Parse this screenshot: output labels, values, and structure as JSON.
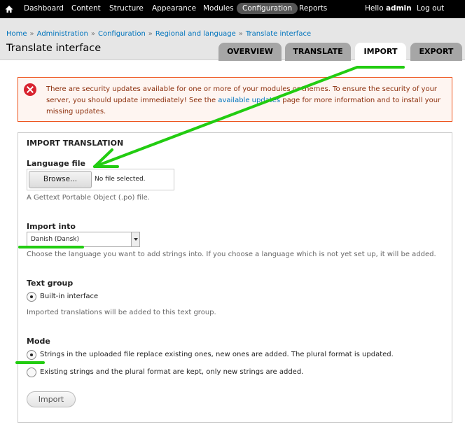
{
  "toolbar": {
    "items": [
      "Dashboard",
      "Content",
      "Structure",
      "Appearance",
      "Modules",
      "Configuration",
      "Reports"
    ],
    "hello_prefix": "Hello",
    "user": "admin",
    "logout": "Log out"
  },
  "breadcrumb": [
    "Home",
    "Administration",
    "Configuration",
    "Regional and language",
    "Translate interface"
  ],
  "breadcrumb_separator": "»",
  "page_title": "Translate interface",
  "tabs": [
    "OVERVIEW",
    "TRANSLATE",
    "IMPORT",
    "EXPORT"
  ],
  "active_tab": "IMPORT",
  "message": {
    "part1": "There are security updates available for one or more of your modules or themes. To ensure the security of your server, you should update immediately! See the ",
    "link": "available updates",
    "part2": " page for more information and to install your missing updates."
  },
  "form": {
    "legend": "IMPORT TRANSLATION",
    "file": {
      "label": "Language file",
      "button": "Browse...",
      "status": "No file selected.",
      "description": "A Gettext Portable Object (.po) file."
    },
    "import_into": {
      "label": "Import into",
      "selected": "Danish (Dansk)",
      "description": "Choose the language you want to add strings into. If you choose a language which is not yet set up, it will be added."
    },
    "text_group": {
      "label": "Text group",
      "option": "Built-in interface",
      "description": "Imported translations will be added to this text group."
    },
    "mode": {
      "label": "Mode",
      "options": [
        "Strings in the uploaded file replace existing ones, new ones are added. The plural format is updated.",
        "Existing strings and the plural format are kept, only new strings are added."
      ],
      "selected_index": 0
    },
    "submit": "Import"
  },
  "colors": {
    "toolbar_bg": "#000000",
    "link": "#0074bd",
    "error_border": "#ed541d",
    "error_text": "#8c2e0b",
    "annotation": "#22cc11"
  }
}
